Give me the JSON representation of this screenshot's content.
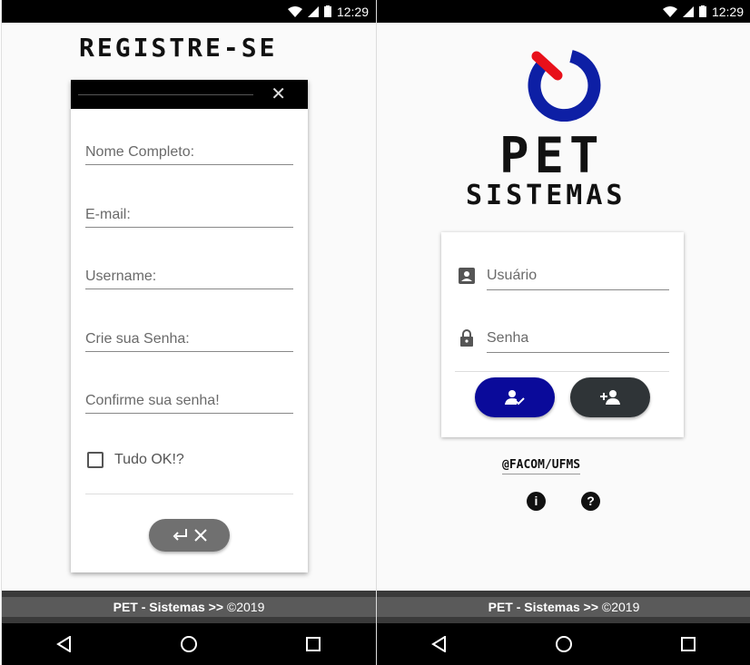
{
  "status_bar": {
    "time": "12:29"
  },
  "register_screen": {
    "title": "REGISTRE-SE",
    "close_icon": "close-icon",
    "fields": {
      "full_name": {
        "placeholder": "Nome Completo:"
      },
      "email": {
        "placeholder": "E-mail:"
      },
      "username": {
        "placeholder": "Username:"
      },
      "password": {
        "placeholder": "Crie sua Senha:"
      },
      "confirm": {
        "placeholder": "Confirme sua senha!"
      }
    },
    "checkbox_label": "Tudo OK!?",
    "submit_icons": [
      "enter-icon",
      "close-icon"
    ]
  },
  "login_screen": {
    "logo_line1": "PET",
    "logo_line2": "SISTEMAS",
    "fields": {
      "user": {
        "placeholder": "Usuário",
        "icon": "account-box-icon"
      },
      "password": {
        "placeholder": "Senha",
        "icon": "lock-icon"
      }
    },
    "login_button_icon": "user-check-icon",
    "register_button_icon": "user-add-icon",
    "handle": "@FACOM/UFMS",
    "info_icon": "i",
    "help_icon": "?"
  },
  "footer": {
    "brand": "PET - Sistemas >>",
    "copyright": "©2019"
  },
  "colors": {
    "login_button": "#0a0a9a",
    "register_button": "#2f3437",
    "logo_blue": "#0d1fa5",
    "logo_red": "#e8101a"
  }
}
